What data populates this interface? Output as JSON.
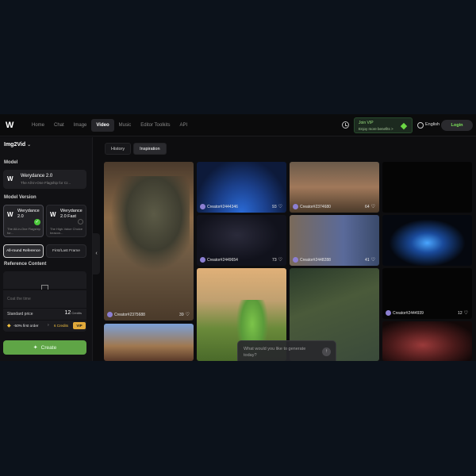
{
  "app": {
    "logo_text": "W"
  },
  "nav": {
    "items": [
      {
        "label": "Home",
        "active": false
      },
      {
        "label": "Chat",
        "active": false
      },
      {
        "label": "Image",
        "active": false
      },
      {
        "label": "Video",
        "active": true
      },
      {
        "label": "Music",
        "active": false
      },
      {
        "label": "Editor Toolkits",
        "active": false
      },
      {
        "label": "API",
        "active": false
      }
    ],
    "vip_title": "Join VIP",
    "vip_subtitle": "Enjoy more benefits >",
    "language": "English",
    "login_label": "Login"
  },
  "sidebar": {
    "mode": "Img2Vid",
    "model_label": "Model",
    "model": {
      "name": "Werydance 2.0",
      "desc": "The All-in-One Flagship for Cr..."
    },
    "version_label": "Model Version",
    "versions": [
      {
        "name": "Werydance 2.0",
        "desc": "The All-in-One Flagship for...",
        "selected": true
      },
      {
        "name": "Werydance 2.0 Fast",
        "desc": "The High-Value Choice beacon...",
        "selected": false
      }
    ],
    "ref_tabs": [
      {
        "label": "All-round Reference",
        "active": true
      },
      {
        "label": "First/Last Frame",
        "active": false
      }
    ],
    "ref_content_label": "Reference Content",
    "prompt_placeholder": "Coat the time",
    "price_label": "Standard price",
    "price_value": "12",
    "price_unit": "Credits",
    "promo_text": "-50% first order",
    "promo_credits": "6 Credits",
    "promo_vip": "VIP",
    "create_label": "Create"
  },
  "main": {
    "tabs": [
      {
        "label": "History",
        "active": false
      },
      {
        "label": "Inspiration",
        "active": true
      }
    ],
    "cards": [
      {
        "creator": "Creator#2375688",
        "likes": "39"
      },
      {
        "creator": "Creator#2444346",
        "likes": "93"
      },
      {
        "creator": "Creator#2374680",
        "likes": "64"
      },
      {
        "creator": "Creator#2449654",
        "likes": "73"
      },
      {
        "creator": "Creator#2448288",
        "likes": "41"
      },
      {
        "creator": "Creator#2444939",
        "likes": "12"
      }
    ],
    "ask_placeholder": "What would you like to generate today?"
  },
  "colors": {
    "accent_green": "#5fa546",
    "vip_gold": "#e1a93a",
    "background": "#0d0d0f"
  }
}
